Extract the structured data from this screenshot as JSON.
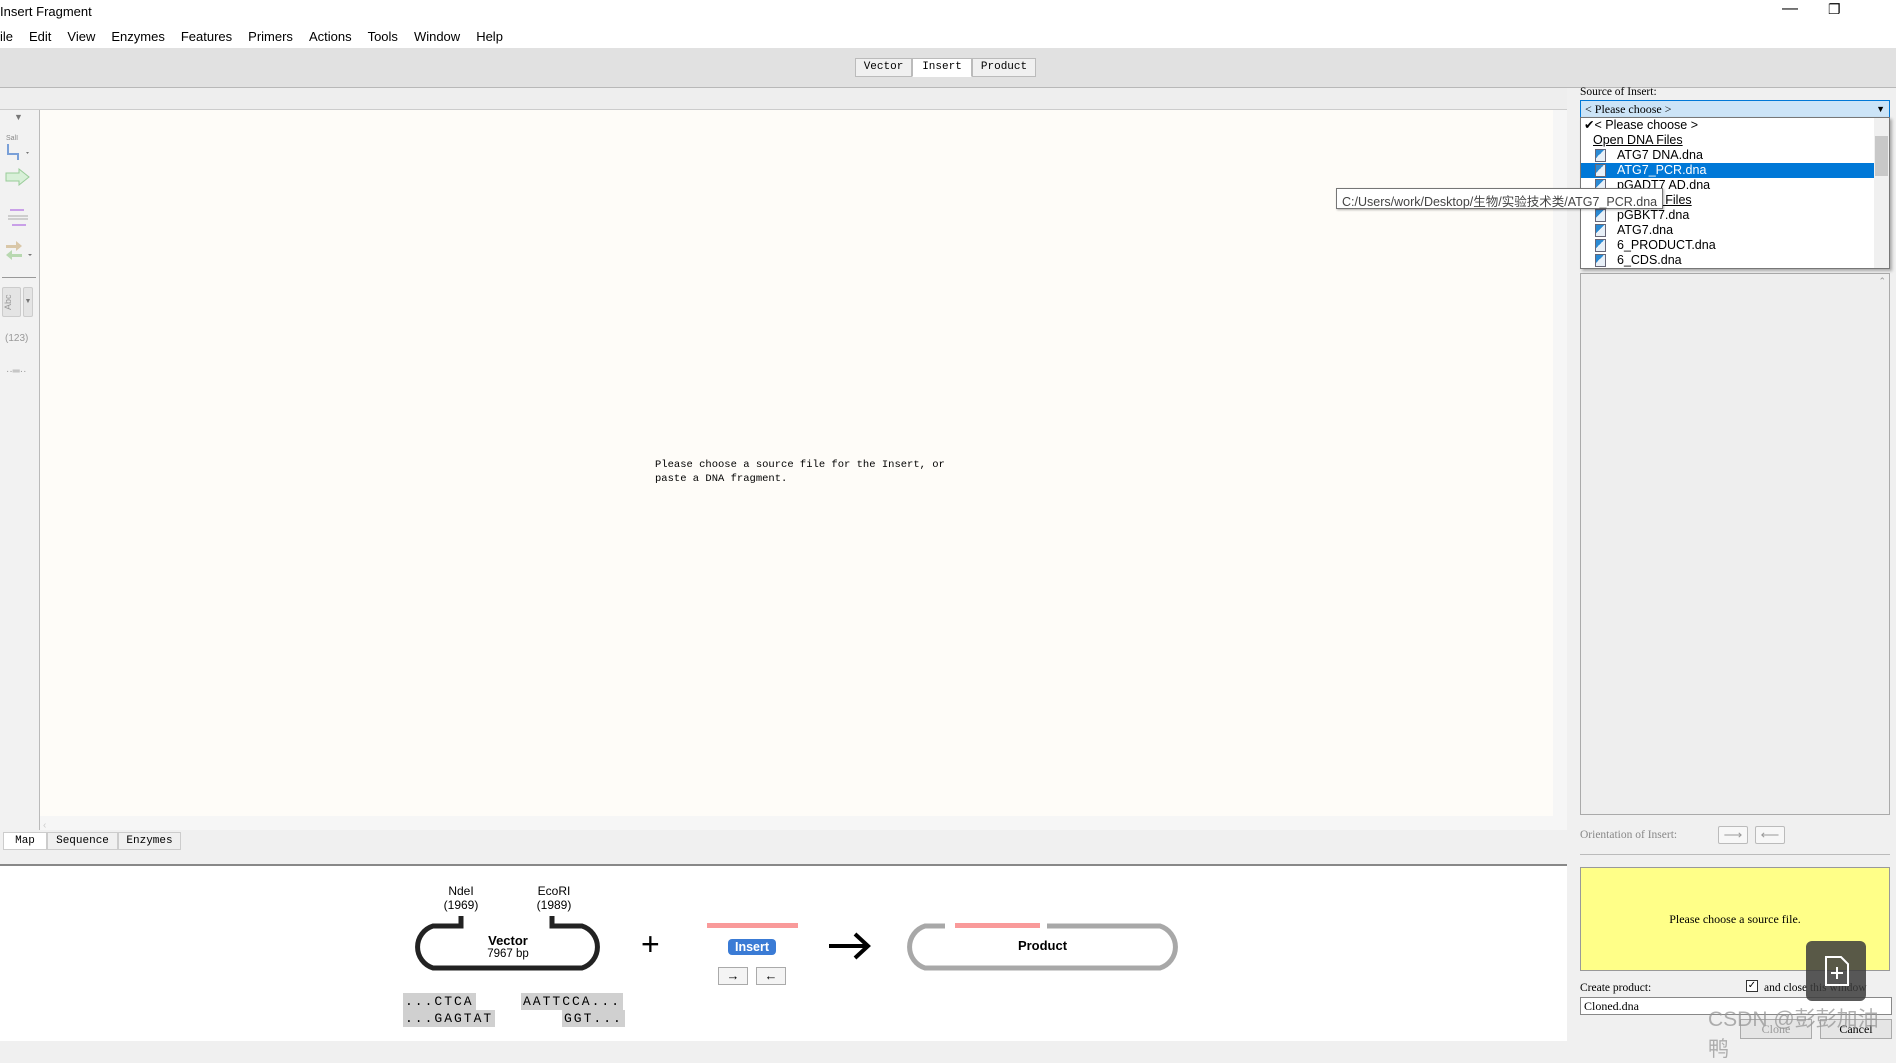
{
  "window": {
    "title": "Insert Fragment",
    "controls": [
      "minimize",
      "restore"
    ]
  },
  "menu": [
    "ile",
    "Edit",
    "View",
    "Enzymes",
    "Features",
    "Primers",
    "Actions",
    "Tools",
    "Window",
    "Help"
  ],
  "top_tabs": [
    {
      "label": "Vector",
      "active": false
    },
    {
      "label": "Insert",
      "active": true
    },
    {
      "label": "Product",
      "active": false
    }
  ],
  "left_toolbar": {
    "abc": "Abc",
    "numbers": "(123)"
  },
  "canvas": {
    "message_line1": "Please choose a source file for the Insert, or",
    "message_line2": "paste a DNA fragment."
  },
  "bottom_tabs": [
    {
      "label": "Map",
      "active": true
    },
    {
      "label": "Sequence",
      "active": false
    },
    {
      "label": "Enzymes",
      "active": false
    }
  ],
  "diagram": {
    "site1": {
      "name": "NdeI",
      "pos": "(1969)"
    },
    "site2": {
      "name": "EcoRI",
      "pos": "(1989)"
    },
    "vector_label": "Vector",
    "vector_size": "7967 bp",
    "plus": "+",
    "insert_label": "Insert",
    "product_label": "Product",
    "left_top": "...CTCA",
    "left_bottom": "...GAGTAT",
    "right_top": "AATTCCA...",
    "right_bottom": "GGT...",
    "colors": {
      "insert_bar": "#f99a9a",
      "insert_badge": "#3a7bd5",
      "product_outline": "#a8a8a8"
    }
  },
  "right_panel": {
    "source_label": "Source of Insert:",
    "source_value": "< Please choose >",
    "dropdown": {
      "checked": "< Please choose >",
      "open_header": "Open DNA Files",
      "open_files": [
        "ATG7 DNA.dna",
        "ATG7_PCR.dna",
        "pGADT7 AD.dna"
      ],
      "selected": "ATG7_PCR.dna",
      "recent_header": "Recent DNA Files",
      "recent_files": [
        "pGBKT7.dna",
        "ATG7.dna",
        "6_PRODUCT.dna",
        "6_CDS.dna"
      ]
    },
    "tooltip": "C:/Users/work/Desktop/生物/实验技术类/ATG7_PCR.dna",
    "orientation_label": "Orientation of Insert:",
    "status_message": "Please choose a source file.",
    "create_label": "Create product:",
    "close_checkbox_label": "and close this window",
    "close_checked": true,
    "product_name": "Cloned.dna",
    "clone_button": "Clone",
    "cancel_button": "Cancel"
  },
  "watermark": "CSDN @彭彭加油鸭"
}
